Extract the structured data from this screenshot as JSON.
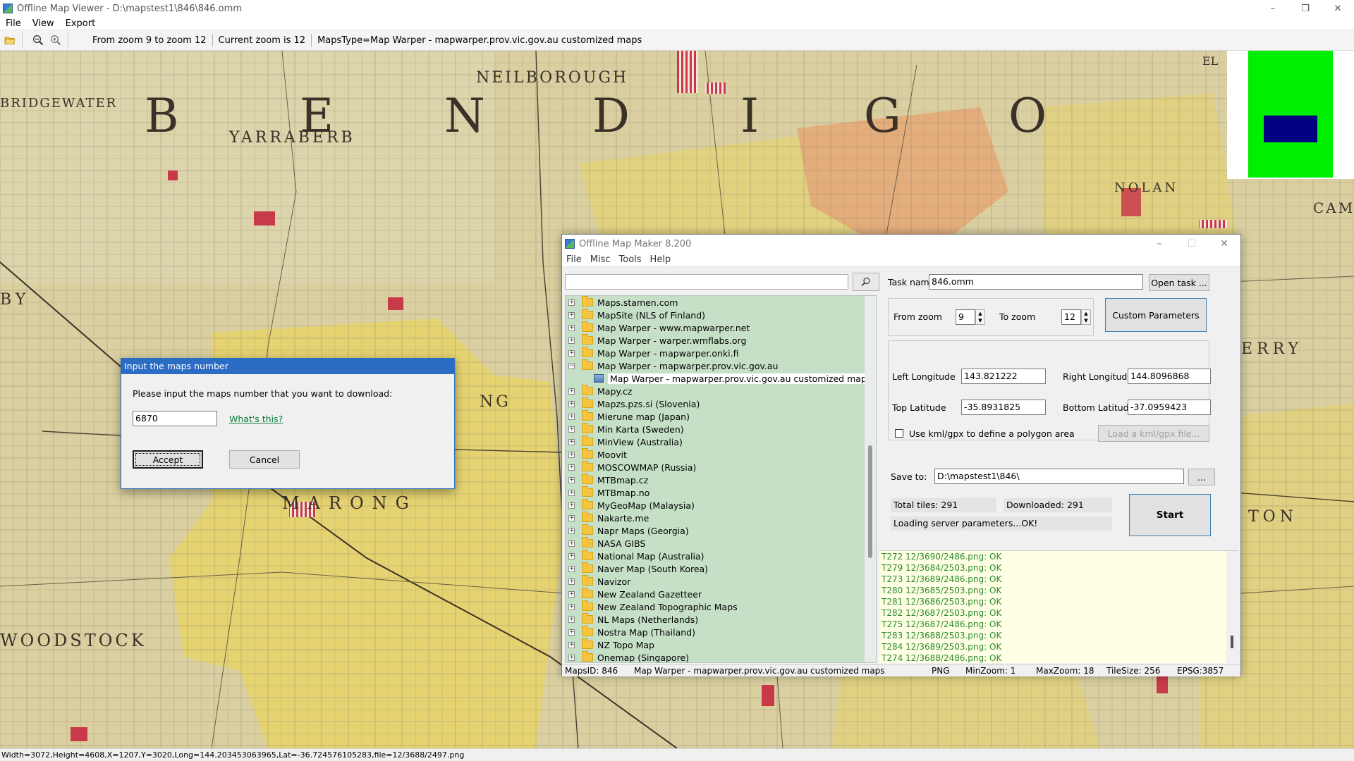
{
  "app": {
    "title": "Offline Map Viewer - D:\\mapstest1\\846\\846.omm",
    "menu": [
      "File",
      "View",
      "Export"
    ],
    "window_buttons": [
      "–",
      "❐",
      "✕"
    ]
  },
  "toolbar": {
    "zoom_range": "From zoom 9 to zoom 12",
    "current_zoom": "Current zoom is 12",
    "maps_type": "MapsType=Map Warper - mapwarper.prov.vic.gov.au customized maps"
  },
  "map": {
    "labels": [
      "NEILBOROUGH",
      "YARRABERB",
      "BRIDGEWATER",
      "MARONG",
      "WOODSTOCK",
      "NOLAN",
      "ERRY",
      "TON",
      "B",
      "E",
      "N",
      "D",
      "I",
      "G",
      "O",
      "BY",
      "NG",
      "CAM",
      "EL"
    ],
    "colors": {
      "parchment": "#d9cfa0",
      "yellow_parcel": "#e6d36a",
      "orange_parcel": "#e3a878",
      "red_hatch": "#c83a4a",
      "grid_line": "#8a7d6a"
    }
  },
  "overview": {
    "colors": {
      "background": "#00ee00",
      "viewport": "#000080"
    }
  },
  "status_bar": {
    "text": "Width=3072,Height=4608,X=1207,Y=3020,Long=144.203453063965,Lat=-36.724576105283,file=12/3688/2497.png"
  },
  "omm": {
    "title": "Offline Map Maker 8.200",
    "menu": [
      "File",
      "Misc",
      "Tools",
      "Help"
    ],
    "search": {
      "value": "",
      "icon": "search-icon"
    },
    "tree": [
      {
        "label": "Maps.stamen.com",
        "expanded": false
      },
      {
        "label": "MapSite (NLS of Finland)",
        "expanded": false
      },
      {
        "label": "Map Warper - www.mapwarper.net",
        "expanded": false
      },
      {
        "label": "Map Warper - warper.wmflabs.org",
        "expanded": false
      },
      {
        "label": "Map Warper - mapwarper.onki.fi",
        "expanded": false
      },
      {
        "label": "Map Warper - mapwarper.prov.vic.gov.au",
        "expanded": true
      },
      {
        "label": "Mapy.cz",
        "expanded": false
      },
      {
        "label": "Mapzs.pzs.si (Slovenia)",
        "expanded": false
      },
      {
        "label": "Mierune map (Japan)",
        "expanded": false
      },
      {
        "label": "Min Karta (Sweden)",
        "expanded": false
      },
      {
        "label": "MinView (Australia)",
        "expanded": false
      },
      {
        "label": "Moovit",
        "expanded": false
      },
      {
        "label": "MOSCOWMAP (Russia)",
        "expanded": false
      },
      {
        "label": "MTBmap.cz",
        "expanded": false
      },
      {
        "label": "MTBmap.no",
        "expanded": false
      },
      {
        "label": "MyGeoMap (Malaysia)",
        "expanded": false
      },
      {
        "label": "Nakarte.me",
        "expanded": false
      },
      {
        "label": "Napr Maps (Georgia)",
        "expanded": false
      },
      {
        "label": "NASA GIBS",
        "expanded": false
      },
      {
        "label": "National Map (Australia)",
        "expanded": false
      },
      {
        "label": "Naver Map (South Korea)",
        "expanded": false
      },
      {
        "label": "Navizor",
        "expanded": false
      },
      {
        "label": "New Zealand Gazetteer",
        "expanded": false
      },
      {
        "label": "New Zealand Topographic Maps",
        "expanded": false
      },
      {
        "label": "NL Maps (Netherlands)",
        "expanded": false
      },
      {
        "label": "Nostra Map (Thailand)",
        "expanded": false
      },
      {
        "label": "NZ Topo Map",
        "expanded": false
      },
      {
        "label": "Onemap (Singapore)",
        "expanded": false
      }
    ],
    "tree_child": "Map Warper - mapwarper.prov.vic.gov.au customized maps",
    "task": {
      "label": "Task name",
      "value": "846.omm",
      "open_button": "Open task ..."
    },
    "zoom": {
      "from_label": "From zoom",
      "from_value": "9",
      "to_label": "To zoom",
      "to_value": "12",
      "custom_button": "Custom Parameters"
    },
    "coords": {
      "left_lon_label": "Left Longitude",
      "left_lon": "143.821222",
      "right_lon_label": "Right Longitude",
      "right_lon": "144.8096868",
      "top_lat_label": "Top Latitude",
      "top_lat": "-35.8931825",
      "bottom_lat_label": "Bottom Latitude",
      "bottom_lat": "-37.0959423",
      "kml_label": "Use kml/gpx to define a polygon area",
      "kml_button": "Load a kml/gpx file..."
    },
    "save": {
      "label": "Save to:",
      "value": "D:\\mapstest1\\846\\",
      "browse": "..."
    },
    "progress": {
      "total": "Total tiles: 291",
      "downloaded": "Downloaded: 291",
      "status": "Loading server parameters...OK!",
      "start_button": "Start"
    },
    "log": [
      "T272 12/3690/2486.png: OK",
      "T279 12/3684/2503.png: OK",
      "T273 12/3689/2486.png: OK",
      "T280 12/3685/2503.png: OK",
      "T281 12/3686/2503.png: OK",
      "T282 12/3687/2503.png: OK",
      "T275 12/3687/2486.png: OK",
      "T283 12/3688/2503.png: OK",
      "T284 12/3689/2503.png: OK",
      "T274 12/3688/2486.png: OK"
    ],
    "status": {
      "maps_id": "MapsID: 846",
      "maps_name": "Map Warper - mapwarper.prov.vic.gov.au customized maps",
      "format": "PNG",
      "min_zoom": "MinZoom: 1",
      "max_zoom": "MaxZoom: 18",
      "tile_size": "TileSize: 256",
      "epsg": "EPSG:3857"
    }
  },
  "dialog": {
    "title": "Input the maps number",
    "message": "Please input the maps number that you want to download:",
    "value": "6870",
    "link": "What's this?",
    "accept": "Accept",
    "cancel": "Cancel"
  }
}
